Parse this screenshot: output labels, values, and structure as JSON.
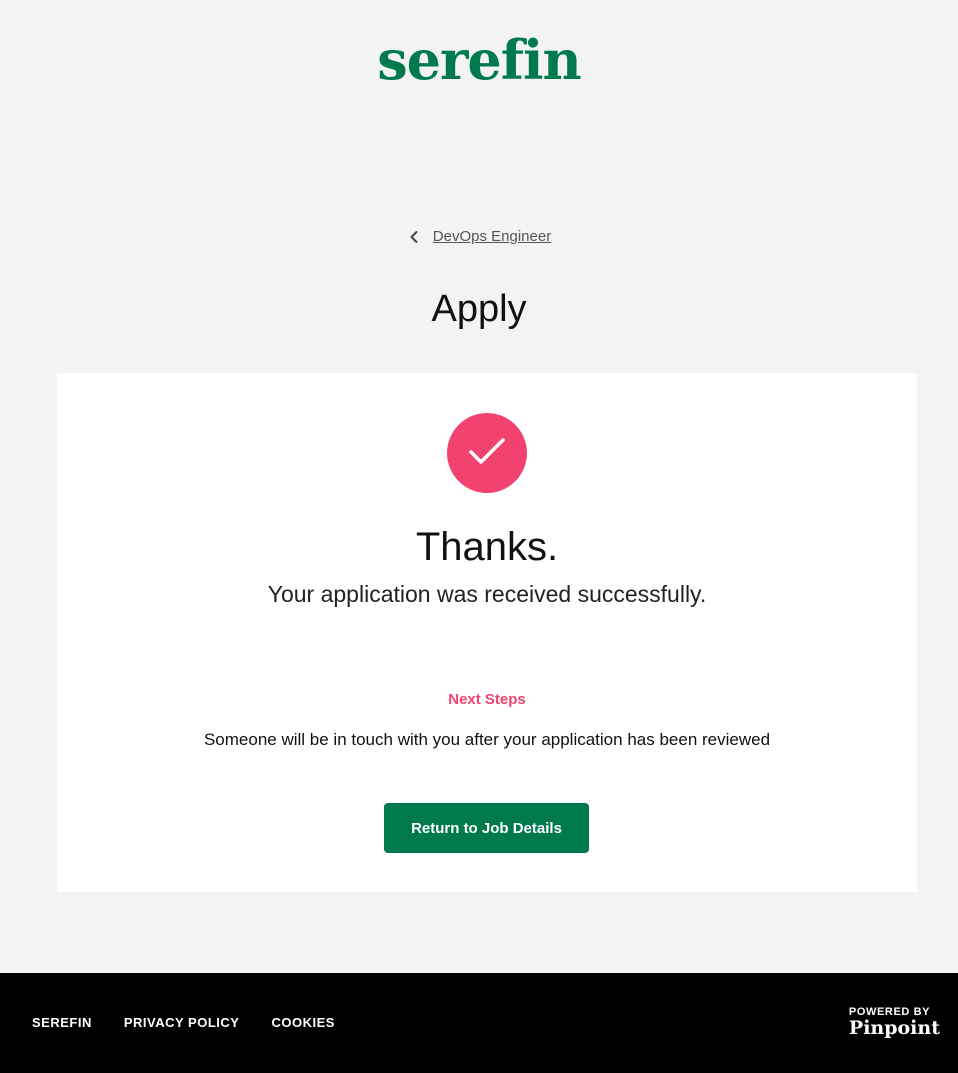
{
  "brand": {
    "logo_text": "serefin",
    "logo_color": "#007a4c"
  },
  "nav": {
    "back_label": "DevOps Engineer",
    "back_icon": "chevron-left-icon"
  },
  "page": {
    "title": "Apply"
  },
  "confirmation": {
    "icon": "checkmark-icon",
    "icon_bg": "#f24370",
    "heading": "Thanks.",
    "message": "Your application was received successfully.",
    "next_steps_label": "Next Steps",
    "next_steps_text": "Someone will be in touch with you after your application has been reviewed",
    "return_button": "Return to Job Details",
    "button_color": "#007a4c"
  },
  "footer": {
    "links": [
      "SEREFIN",
      "PRIVACY POLICY",
      "COOKIES"
    ],
    "powered_by": "POWERED BY",
    "powered_brand": "Pinpoint"
  }
}
